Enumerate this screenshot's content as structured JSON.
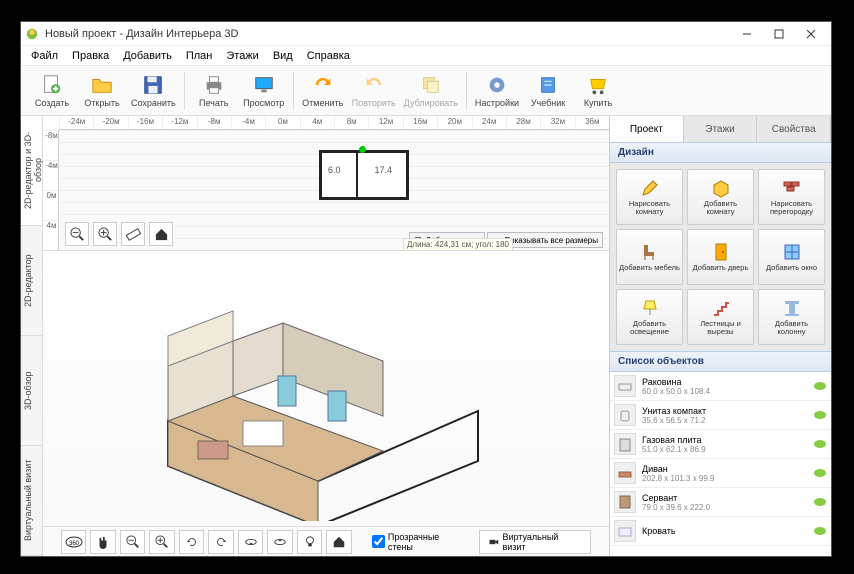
{
  "window": {
    "title": "Новый проект - Дизайн Интерьера 3D"
  },
  "menu": [
    "Файл",
    "Правка",
    "Добавить",
    "План",
    "Этажи",
    "Вид",
    "Справка"
  ],
  "toolbar": [
    {
      "id": "create",
      "label": "Создать"
    },
    {
      "id": "open",
      "label": "Открыть"
    },
    {
      "id": "save",
      "label": "Сохранить"
    },
    {
      "id": "sep"
    },
    {
      "id": "print",
      "label": "Печать"
    },
    {
      "id": "view",
      "label": "Просмотр"
    },
    {
      "id": "sep"
    },
    {
      "id": "undo",
      "label": "Отменить"
    },
    {
      "id": "redo",
      "label": "Повторить",
      "disabled": true
    },
    {
      "id": "dup",
      "label": "Дублировать",
      "disabled": true
    },
    {
      "id": "sep"
    },
    {
      "id": "settings",
      "label": "Настройки"
    },
    {
      "id": "tutorial",
      "label": "Учебник"
    },
    {
      "id": "buy",
      "label": "Купить"
    }
  ],
  "side_tabs": [
    "2D-редактор и 3D-обзор",
    "2D-редактор",
    "3D-обзор",
    "Виртуальный визит"
  ],
  "ruler_h": [
    "-24м",
    "-20м",
    "-16м",
    "-12м",
    "-8м",
    "-4м",
    "0м",
    "4м",
    "8м",
    "12м",
    "16м",
    "20м",
    "24м",
    "28м",
    "32м",
    "36м"
  ],
  "ruler_v": [
    "-8м",
    "-4м",
    "0м",
    "4м"
  ],
  "plan": {
    "room1": "6.0",
    "room2": "17.4",
    "hint": "Длина: 424,31 см; угол: 180",
    "ctx1": "Добавить этаж",
    "ctx2": "Показывать все размеры"
  },
  "bottom": {
    "transparent": "Прозрачные стены",
    "virtual": "Виртуальный визит"
  },
  "right": {
    "tabs": [
      "Проект",
      "Этажи",
      "Свойства"
    ],
    "design_head": "Дизайн",
    "design_buttons": [
      "Нарисовать комнату",
      "Добавить комнату",
      "Нарисовать перегородку",
      "Добавить мебель",
      "Добавить дверь",
      "Добавить окно",
      "Добавить освещение",
      "Лестницы и вырезы",
      "Добавить колонну"
    ],
    "objects_head": "Список объектов",
    "objects": [
      {
        "name": "Раковина",
        "dim": "60.0 x 50.0 x 108.4"
      },
      {
        "name": "Унитаз компакт",
        "dim": "35.6 x 56.5 x 71.2"
      },
      {
        "name": "Газовая плита",
        "dim": "51.0 x 62.1 x 86.9"
      },
      {
        "name": "Диван",
        "dim": "202.8 x 101.3 x 99.9"
      },
      {
        "name": "Сервант",
        "dim": "79.0 x 39.6 x 222.0"
      },
      {
        "name": "Кровать",
        "dim": ""
      }
    ]
  }
}
